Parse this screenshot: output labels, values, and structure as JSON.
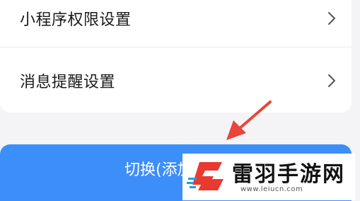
{
  "settings": {
    "items": [
      {
        "label": "小程序权限设置",
        "icon": "chevron-right-icon"
      },
      {
        "label": "消息提醒设置",
        "icon": "chevron-right-icon"
      }
    ]
  },
  "switch_button": {
    "label": "切换(添加"
  },
  "annotation": {
    "icon": "red-arrow-icon",
    "color": "#e8453c"
  },
  "watermark": {
    "title": "雷羽手游网",
    "url": "www.leiucn.com",
    "icon": "leiyu-logo-icon",
    "colors": {
      "red": "#e83a2e",
      "blue": "#1aa0e8"
    }
  },
  "theme": {
    "accent": "#3c8ef8",
    "background": "#f4f4f6",
    "card": "#ffffff"
  }
}
